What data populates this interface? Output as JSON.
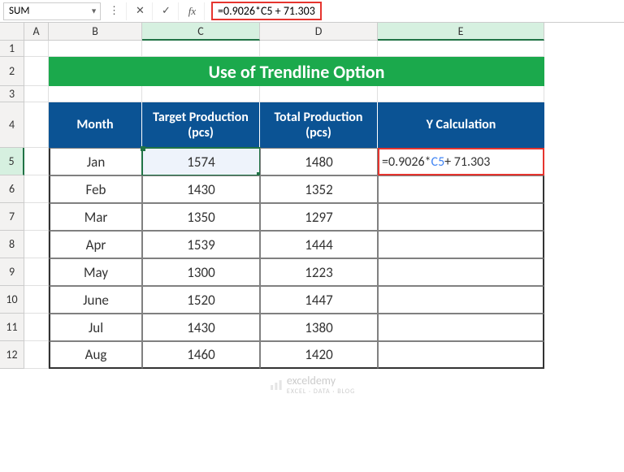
{
  "nameBox": "SUM",
  "formulaBar": "=0.9026*C5 + 71.303",
  "columns": [
    "A",
    "B",
    "C",
    "D",
    "E"
  ],
  "rows": [
    "1",
    "2",
    "3",
    "4",
    "5",
    "6",
    "7",
    "8",
    "9",
    "10",
    "11",
    "12"
  ],
  "title": "Use of Trendline Option",
  "headers": {
    "month": "Month",
    "target": "Target Production (pcs)",
    "total": "Total Production (pcs)",
    "ycalc": "Y Calculation"
  },
  "activeFormulaPrefix": "=0.9026*",
  "activeFormulaRef": "C5",
  "activeFormulaSuffix": " + 71.303",
  "data": [
    {
      "month": "Jan",
      "target": "1574",
      "total": "1480"
    },
    {
      "month": "Feb",
      "target": "1430",
      "total": "1352"
    },
    {
      "month": "Mar",
      "target": "1350",
      "total": "1297"
    },
    {
      "month": "Apr",
      "target": "1539",
      "total": "1444"
    },
    {
      "month": "May",
      "target": "1300",
      "total": "1223"
    },
    {
      "month": "June",
      "target": "1520",
      "total": "1447"
    },
    {
      "month": "Jul",
      "target": "1430",
      "total": "1380"
    },
    {
      "month": "Aug",
      "target": "1460",
      "total": "1420"
    }
  ],
  "watermark": {
    "brand": "exceldemy",
    "tag": "EXCEL · DATA · BLOG"
  }
}
